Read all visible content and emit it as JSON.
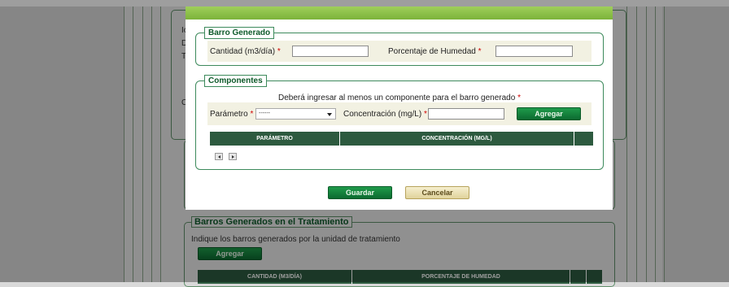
{
  "background": {
    "section_legend": "Barros Generados en el Tratamiento",
    "instruction": "Indique los barros generados por la unidad de tratamiento",
    "add_button": "Agregar",
    "table_headers": [
      "CANTIDAD (M3/DÍA)",
      "PORCENTAJE DE HUMEDAD"
    ],
    "left_letters": [
      "Ic",
      "D",
      "T",
      "C"
    ]
  },
  "modal": {
    "barro": {
      "legend": "Barro Generado",
      "cantidad_label": "Cantidad (m3/día)",
      "cantidad_value": "",
      "humedad_label": "Porcentaje de Humedad",
      "humedad_value": "",
      "required_mark": "*"
    },
    "componentes": {
      "legend": "Componentes",
      "notice": "Deberá ingresar al menos un componente para el barro generado",
      "parametro_label": "Parámetro",
      "parametro_selected": "------",
      "concentracion_label": "Concentración (mg/L)",
      "concentracion_value": "",
      "add_button": "Agregar",
      "table_headers": [
        "PARÁMETRO",
        "CONCENTRACIÓN (MG/L)"
      ]
    },
    "save_button": "Guardar",
    "cancel_button": "Cancelar"
  },
  "colors": {
    "accent_green": "#0c6a30",
    "header_green": "#2d5a3f",
    "bar_green": "#8cc044",
    "required_red": "#d00000"
  }
}
